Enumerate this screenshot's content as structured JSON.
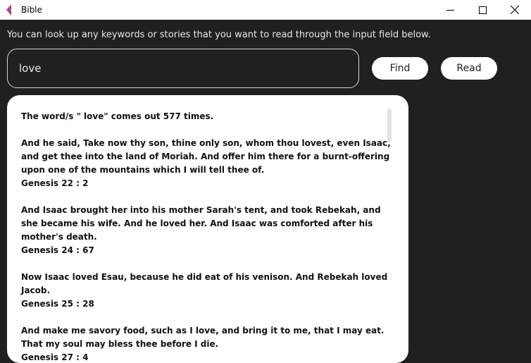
{
  "window": {
    "title": "Bible",
    "accent_colors": [
      "#e8344c",
      "#3b6fd6",
      "#8d4fd0"
    ]
  },
  "instruction": "You can look up any keywords or stories that you want to read through the input field below.",
  "search": {
    "value": "love",
    "find_label": "Find",
    "read_label": "Read"
  },
  "results": {
    "count_line": "The word/s \" love\" comes out 577 times.",
    "verses": [
      {
        "text": "And he said, Take now thy son, thine only son, whom thou lovest, even Isaac, and get thee into the land of Moriah. And offer him there for a burnt-offering upon one of the mountains which I will tell thee of.",
        "ref": "Genesis 22 : 2"
      },
      {
        "text": "And Isaac brought her into his mother Sarah's tent, and took Rebekah, and she became his wife. And he loved her. And Isaac was comforted after his mother's death.",
        "ref": "Genesis 24 : 67"
      },
      {
        "text": "Now Isaac loved Esau, because he did eat of his venison. And Rebekah loved Jacob.",
        "ref": "Genesis 25 : 28"
      },
      {
        "text": "And make me savory food, such as I love, and bring it to me, that I may eat. That my soul may bless thee before I die.",
        "ref": "Genesis 27 : 4"
      }
    ]
  }
}
